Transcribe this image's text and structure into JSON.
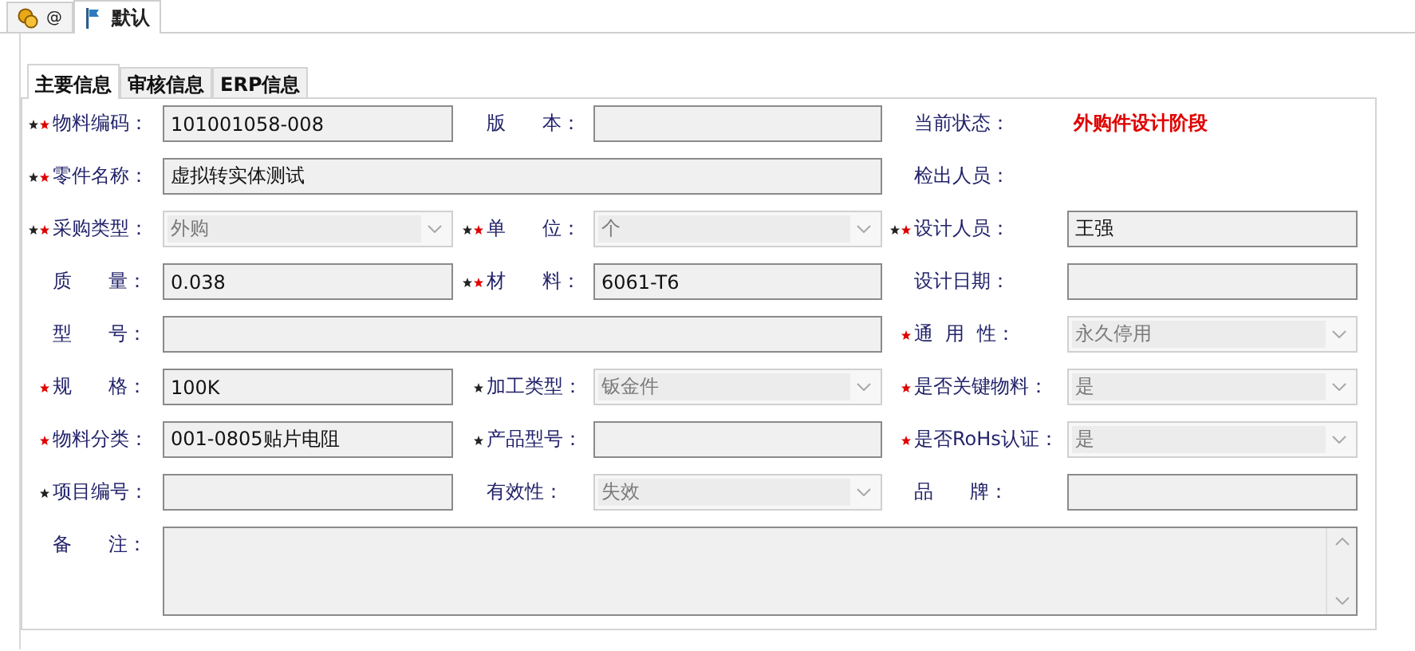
{
  "top_tabs": [
    {
      "label": "@",
      "selected": false
    },
    {
      "label": "默认",
      "selected": true
    }
  ],
  "form_tabs": [
    {
      "label": "主要信息",
      "selected": true
    },
    {
      "label": "审核信息",
      "selected": false
    },
    {
      "label": "ERP信息",
      "selected": false
    }
  ],
  "rows": [
    {
      "cells": [
        {
          "black_star": true,
          "red_star": true,
          "label": "物料编码：",
          "kind": "text",
          "value": "101001058-008"
        },
        {
          "black_star": false,
          "red_star": false,
          "label": "版      本：",
          "kind": "text"
        },
        {
          "black_star": false,
          "red_star": false,
          "label": "当前状态：",
          "kind": "status",
          "value": "外购件设计阶段"
        }
      ]
    },
    {
      "cells": [
        {
          "black_star": true,
          "red_star": true,
          "label": "零件名称：",
          "kind": "wide_text",
          "value": "虚拟转实体测试"
        },
        {
          "black_star": false,
          "red_star": false,
          "label": "检出人员：",
          "kind": "label_only"
        }
      ]
    },
    {
      "cells": [
        {
          "black_star": true,
          "red_star": true,
          "label": "采购类型：",
          "kind": "combo",
          "disabled": true,
          "value": "外购"
        },
        {
          "black_star": true,
          "red_star": true,
          "label": "单      位：",
          "kind": "combo",
          "disabled": true,
          "value": "个"
        },
        {
          "black_star": true,
          "red_star": true,
          "label": "设计人员：",
          "kind": "text",
          "value": "王强"
        }
      ]
    },
    {
      "cells": [
        {
          "black_star": false,
          "red_star": false,
          "label": "质      量：",
          "kind": "text",
          "value": "0.038"
        },
        {
          "black_star": true,
          "red_star": true,
          "label": "材      料：",
          "kind": "text",
          "value": "6061-T6"
        },
        {
          "black_star": false,
          "red_star": false,
          "label": "设计日期：",
          "kind": "text"
        }
      ]
    },
    {
      "cells": [
        {
          "black_star": false,
          "red_star": false,
          "label": "型      号：",
          "kind": "wide_text"
        },
        {
          "black_star": false,
          "red_star": true,
          "label": "通  用  性：",
          "kind": "combo",
          "disabled": true,
          "value": "永久停用"
        }
      ]
    },
    {
      "cells": [
        {
          "black_star": false,
          "red_star": true,
          "label": "规      格：",
          "kind": "text",
          "value": "100K"
        },
        {
          "black_star": true,
          "red_star": false,
          "label": "加工类型：",
          "kind": "combo",
          "disabled": true,
          "value": "钣金件"
        },
        {
          "black_star": false,
          "red_star": true,
          "label": "是否关键物料：",
          "kind": "combo",
          "disabled": true,
          "value": "是"
        }
      ]
    },
    {
      "cells": [
        {
          "black_star": false,
          "red_star": true,
          "label": "物料分类：",
          "kind": "text",
          "value": "001-0805贴片电阻"
        },
        {
          "black_star": true,
          "red_star": false,
          "label": "产品型号：",
          "kind": "text"
        },
        {
          "black_star": false,
          "red_star": true,
          "label": "是否RoHs认证：",
          "kind": "combo",
          "disabled": true,
          "value": "是"
        }
      ]
    },
    {
      "cells": [
        {
          "black_star": true,
          "red_star": false,
          "label": "项目编号：",
          "kind": "text"
        },
        {
          "black_star": false,
          "red_star": false,
          "label": "有效性：",
          "kind": "combo",
          "disabled": true,
          "value": "失效"
        },
        {
          "black_star": false,
          "red_star": false,
          "label": "品      牌：",
          "kind": "text"
        }
      ]
    },
    {
      "cells": [
        {
          "black_star": false,
          "red_star": false,
          "label": "备      注：",
          "kind": "memo"
        }
      ]
    }
  ]
}
